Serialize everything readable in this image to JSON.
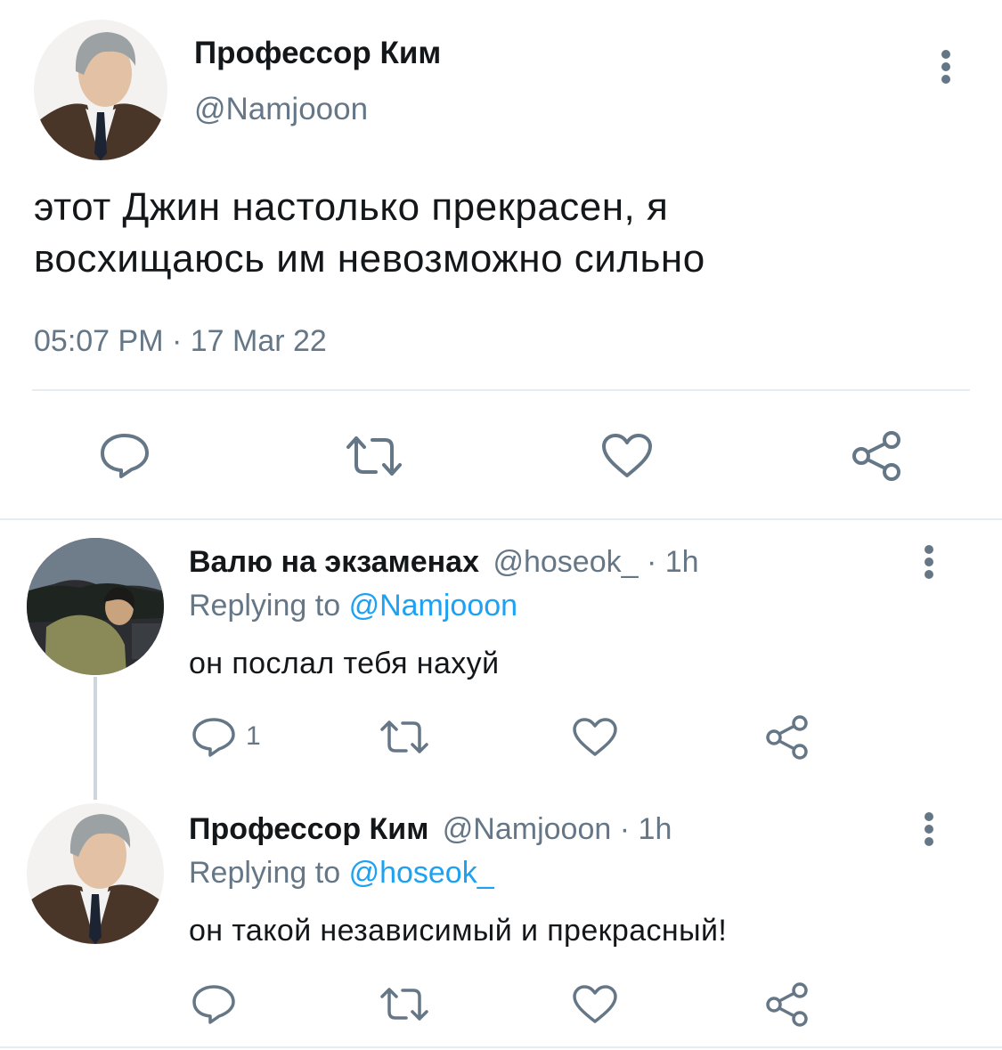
{
  "main_tweet": {
    "display_name": "Профессор Ким",
    "handle": "@Namjooon",
    "text_line1": "этот Джин настолько прекрасен, я",
    "text_line2": "восхищаюсь им невозможно сильно",
    "timestamp": "05:07 PM · 17 Mar 22"
  },
  "replies": [
    {
      "display_name": "Валю на экзаменах",
      "handle": "@hoseok_",
      "separator": "·",
      "time": "1h",
      "replying_prefix": "Replying to",
      "replying_to": "@Namjooon",
      "text": "он послал тебя нахуй",
      "reply_count": "1"
    },
    {
      "display_name": "Профессор Ким",
      "handle": "@Namjooon",
      "separator": "·",
      "time": "1h",
      "replying_prefix": "Replying to",
      "replying_to": "@hoseok_",
      "text": "он такой независимый и прекрасный!"
    }
  ],
  "icons": {
    "reply": "speech-bubble-icon",
    "retweet": "retweet-arrows-icon",
    "like": "heart-icon",
    "share": "share-nodes-icon",
    "more": "vertical-dots-icon"
  },
  "colors": {
    "text": "#14171a",
    "muted": "#657786",
    "link": "#1da1f2",
    "divider": "#e6ecf0"
  }
}
